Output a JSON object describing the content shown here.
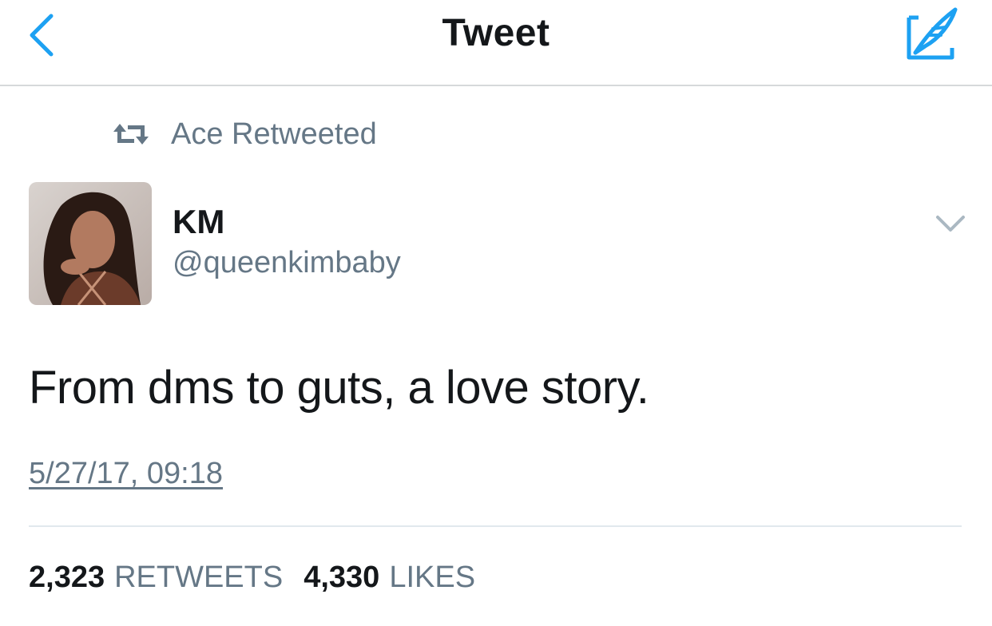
{
  "nav": {
    "title": "Tweet",
    "back_icon": "chevron-left-icon",
    "compose_icon": "compose-quill-icon",
    "accent_color": "#1da1f2"
  },
  "social_context": {
    "icon": "retweet-icon",
    "text": "Ace Retweeted"
  },
  "user": {
    "name": "KM",
    "handle": "@queenkimbaby",
    "avatar": "profile-photo"
  },
  "tweet": {
    "text": "From dms to guts, a love story.",
    "timestamp": "5/27/17, 09:18"
  },
  "stats": {
    "retweets_count": "2,323",
    "retweets_label": "RETWEETS",
    "likes_count": "4,330",
    "likes_label": "LIKES"
  },
  "colors": {
    "text_primary": "#14171a",
    "text_secondary": "#657786",
    "divider": "#e1e8ed"
  }
}
